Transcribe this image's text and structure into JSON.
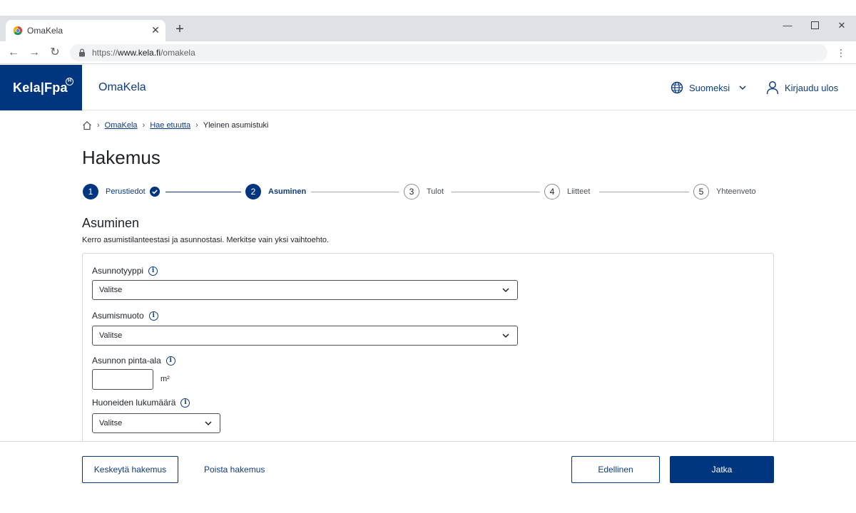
{
  "browser": {
    "tab_title": "OmaKela",
    "url_prefix": "https://",
    "url_host": "www.kela.fi",
    "url_path": "/omakela",
    "icons": [
      "chrome-favicon",
      "close-icon",
      "plus-icon",
      "back-arrow-icon",
      "forward-arrow-icon",
      "reload-icon",
      "lock-icon",
      "more-vert-icon",
      "minimize-icon",
      "maximize-icon",
      "window-close-icon"
    ]
  },
  "header": {
    "logo_text": "Kela|Fpa",
    "logo_mark": "H",
    "app_title": "OmaKela",
    "language_label": "Suomeksi",
    "logout_label": "Kirjaudu ulos"
  },
  "breadcrumb": {
    "items": [
      "OmaKela",
      "Hae etuutta"
    ],
    "current": "Yleinen asumistuki"
  },
  "page": {
    "title": "Hakemus"
  },
  "stepper": {
    "steps": [
      {
        "number": "1",
        "label": "Perustiedot",
        "state": "done"
      },
      {
        "number": "2",
        "label": "Asuminen",
        "state": "active"
      },
      {
        "number": "3",
        "label": "Tulot",
        "state": "pending"
      },
      {
        "number": "4",
        "label": "Liitteet",
        "state": "pending"
      },
      {
        "number": "5",
        "label": "Yhteenveto",
        "state": "pending"
      }
    ]
  },
  "section": {
    "title": "Asuminen",
    "description": "Kerro asumistilanteestasi ja asunnostasi. Merkitse vain yksi vaihtoehto."
  },
  "form": {
    "housing_type": {
      "label": "Asunnotyyppi",
      "value": "Valitse"
    },
    "housing_form": {
      "label": "Asumismuoto",
      "value": "Valitse"
    },
    "floor_area": {
      "label": "Asunnon pinta-ala",
      "value": "",
      "unit": "m²"
    },
    "room_count": {
      "label": "Huoneiden lukumäärä",
      "value": "Valitse"
    },
    "info_glyph": "i"
  },
  "footer": {
    "suspend_label": "Keskeytä hakemus",
    "delete_label": "Poista hakemus",
    "previous_label": "Edellinen",
    "continue_label": "Jatka"
  },
  "colors": {
    "brand": "#003580",
    "link": "#0d3c83",
    "chrome_tabstrip": "#dee1e6",
    "omnibox": "#f1f3f4"
  }
}
